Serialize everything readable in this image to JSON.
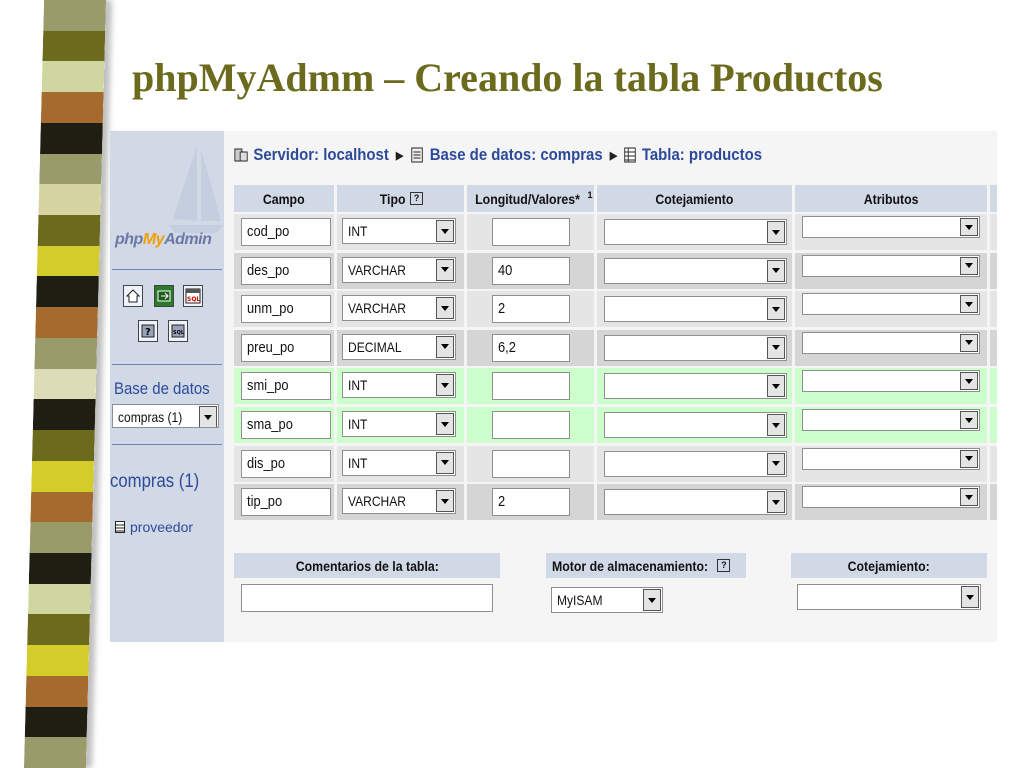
{
  "slide": {
    "title": "phpMyAdmm – Creando la tabla Productos"
  },
  "stripes": [
    "#9a9b6b",
    "#6b6a1d",
    "#cfd6a0",
    "#a56b2e",
    "#1e1e12",
    "#9a9b6b",
    "#d6d4a3",
    "#6b6a1d",
    "#d4cc2a",
    "#1e1e12",
    "#a56b2e",
    "#9a9b6b",
    "#dcdcb8",
    "#1e1e12",
    "#6b6a1d",
    "#d4cc2a",
    "#a56b2e",
    "#9a9b6b",
    "#1e1e12",
    "#cfd6a0",
    "#6b6a1d",
    "#d4cc2a",
    "#a56b2e",
    "#1e1e12",
    "#9a9b6b"
  ],
  "sidebar": {
    "logo": {
      "php": "php",
      "my": "My",
      "admin": "Admin"
    },
    "db_label": "Base de datos",
    "db_select": "compras (1)",
    "db_name": "compras (1)",
    "tables": [
      "proveedor"
    ]
  },
  "breadcrumb": {
    "server": "Servidor: localhost",
    "database": "Base de datos: compras",
    "table": "Tabla: productos"
  },
  "columns": {
    "campo": "Campo",
    "tipo": "Tipo",
    "longitud": "Longitud/Valores*",
    "longitud_sup": "1",
    "cotejamiento": "Cotejamiento",
    "atributos": "Atributos"
  },
  "fields": [
    {
      "name": "cod_po",
      "type": "INT",
      "length": ""
    },
    {
      "name": "des_po",
      "type": "VARCHAR",
      "length": "40"
    },
    {
      "name": "unm_po",
      "type": "VARCHAR",
      "length": "2"
    },
    {
      "name": "preu_po",
      "type": "DECIMAL",
      "length": "6,2"
    },
    {
      "name": "smi_po",
      "type": "INT",
      "length": ""
    },
    {
      "name": "sma_po",
      "type": "INT",
      "length": ""
    },
    {
      "name": "dis_po",
      "type": "INT",
      "length": ""
    },
    {
      "name": "tip_po",
      "type": "VARCHAR",
      "length": "2"
    }
  ],
  "footer": {
    "comentarios_label": "Comentarios de la tabla:",
    "comentarios_value": "",
    "motor_label": "Motor de almacenamiento:",
    "motor_value": "MyISAM",
    "cotejamiento_label": "Cotejamiento:",
    "cotejamiento_value": ""
  },
  "colors": {
    "title": "#6b6a1d",
    "header_bg": "#d1d8e6",
    "row_even": "#e5e5e5",
    "row_odd": "#d5d5d5",
    "row_highlight": "#ccffcc",
    "link": "#2d4a9a"
  }
}
